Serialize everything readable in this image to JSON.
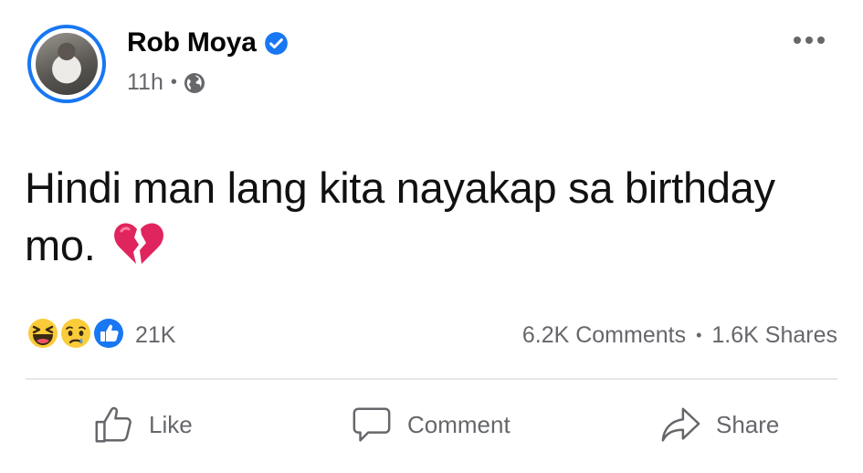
{
  "post": {
    "author_name": "Rob Moya",
    "time": "11h",
    "separator": "•",
    "text": "Hindi man lang kita nayakap sa birthday mo."
  },
  "icons": {
    "verified": "verified-badge-icon",
    "audience": "globe-icon",
    "emoji": "broken-heart-icon",
    "more": "more-options-icon",
    "reactions": [
      "haha-reaction-icon",
      "sad-reaction-icon",
      "like-reaction-icon"
    ],
    "actions": [
      "thumbs-up-icon",
      "comment-bubble-icon",
      "share-arrow-icon"
    ]
  },
  "stats": {
    "reaction_count": "21K",
    "comments": "6.2K Comments",
    "separator": "•",
    "shares": "1.6K Shares"
  },
  "actions": {
    "like_label": "Like",
    "comment_label": "Comment",
    "share_label": "Share"
  },
  "colors": {
    "brand_blue": "#1877f2",
    "secondary_text": "#65676b",
    "divider": "#e4e6eb",
    "broken_heart": "#e0245e"
  }
}
